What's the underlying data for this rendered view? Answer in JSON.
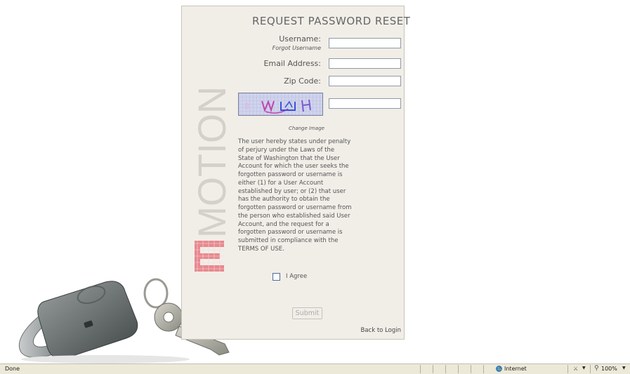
{
  "form": {
    "title": "REQUEST PASSWORD RESET",
    "username_label": "Username:",
    "forgot_username": "Forgot Username",
    "email_label": "Email Address:",
    "zip_label": "Zip Code:",
    "username_value": "",
    "email_value": "",
    "zip_value": "",
    "captcha_value": "",
    "change_image": "Change Image",
    "terms": "The user hereby states under penalty of perjury under the Laws of the State of Washington that the User Account for which the user seeks the forgotten password or username is either (1) for a User Account established by user; or (2) that user has the authority to obtain the forgotten password or username from the person who established said User Account, and the request for a forgotten password or username is submitted in compliance with the TERMS OF USE.",
    "agree_label": "I Agree",
    "agree_checked": false,
    "submit_label": "Submit",
    "back_to_login": "Back to Login"
  },
  "logo": {
    "text": "EMOTION",
    "color_gray": "#d4d0ca",
    "color_red": "#e8888e"
  },
  "status_bar": {
    "status": "Done",
    "zone": "Internet",
    "zoom": "100%"
  },
  "icons": {
    "zone": "globe-icon",
    "protected_mode": "protected-mode-icon",
    "zoom": "magnifier-icon"
  }
}
